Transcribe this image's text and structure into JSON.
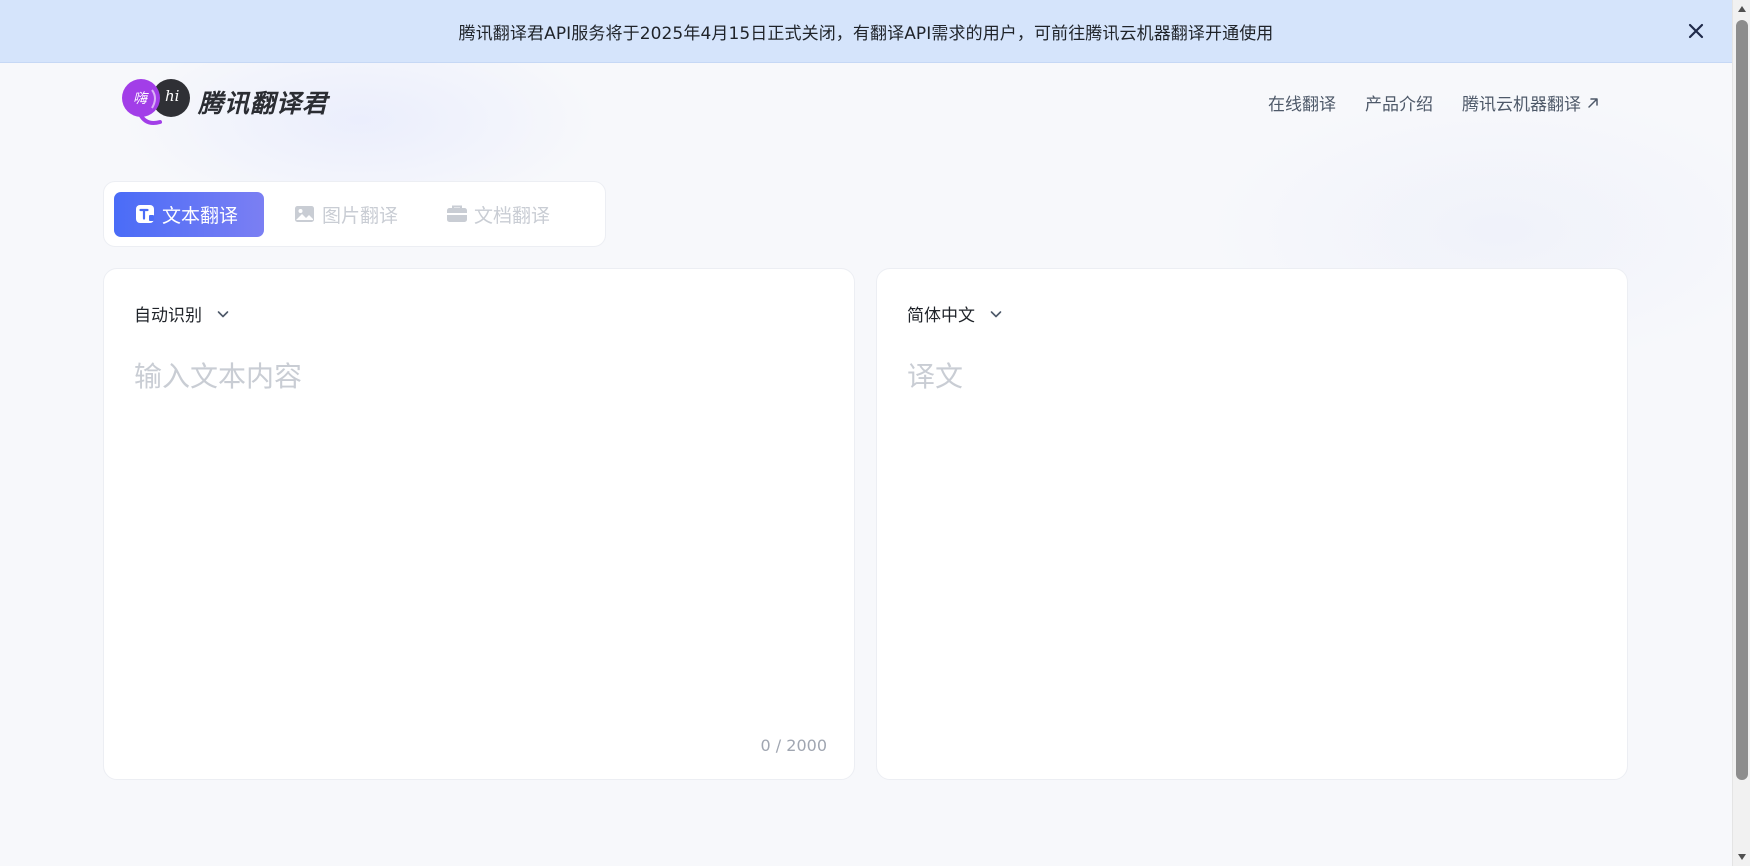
{
  "banner": {
    "text": "腾讯翻译君API服务将于2025年4月15日正式关闭，有翻译API需求的用户，可前往腾讯云机器翻译开通使用"
  },
  "header": {
    "logo_badge_left": "嗨",
    "logo_badge_right": "hi",
    "logo_text": "腾讯翻译君",
    "nav": {
      "online": "在线翻译",
      "product": "产品介绍",
      "cloud": "腾讯云机器翻译"
    }
  },
  "tabs": {
    "text": "文本翻译",
    "image": "图片翻译",
    "document": "文档翻译"
  },
  "source": {
    "language": "自动识别",
    "placeholder": "输入文本内容",
    "value": "",
    "counter": "0 / 2000"
  },
  "target": {
    "language": "简体中文",
    "placeholder": "译文"
  },
  "colors": {
    "accent": "#4a6cf7",
    "accent_end": "#7b7ff3",
    "banner_bg": "#d5e4fb",
    "logo_purple": "#a23ee8",
    "logo_dark": "#2f3035"
  }
}
